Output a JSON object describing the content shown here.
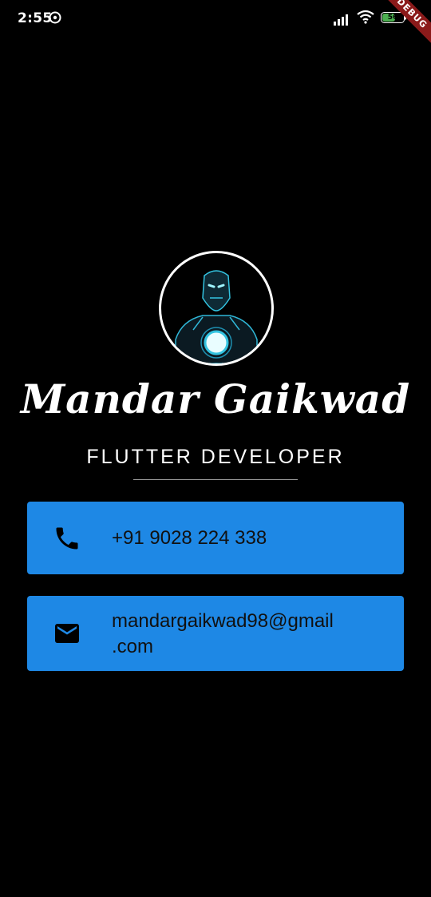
{
  "status_bar": {
    "time": "2:55",
    "battery_level": "56",
    "debug_label": "DEBUG",
    "icons": [
      "data-saver-icon",
      "signal-icon",
      "wifi-icon",
      "battery-icon"
    ]
  },
  "profile": {
    "avatar_icon": "iron-man-avatar",
    "name": "Mandar Gaikwad",
    "title": "FLUTTER DEVELOPER"
  },
  "contacts": {
    "phone": {
      "icon": "phone-icon",
      "text": "+91 9028 224 338"
    },
    "email": {
      "icon": "mail-icon",
      "line1": "mandargaikwad98@gmail",
      "line2": ".com"
    }
  },
  "colors": {
    "background": "#000000",
    "card": "#1e88e5",
    "debug_banner": "#8b1a1a"
  }
}
